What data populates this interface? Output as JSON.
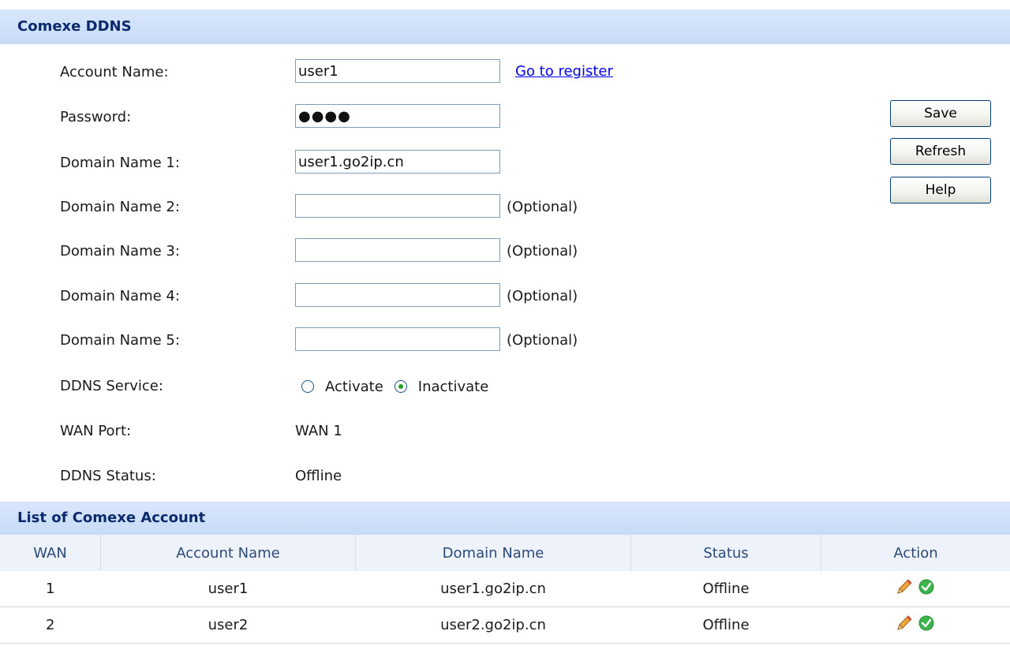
{
  "ddns_section": {
    "title": "Comexe DDNS"
  },
  "form": {
    "account_name": {
      "label": "Account Name:",
      "value": "user1",
      "register_link": "Go to register"
    },
    "password": {
      "label": "Password:",
      "value": "●●●●"
    },
    "domain1": {
      "label": "Domain Name 1:",
      "value": "user1.go2ip.cn"
    },
    "domain2": {
      "label": "Domain Name 2:",
      "value": "",
      "hint": "(Optional)"
    },
    "domain3": {
      "label": "Domain Name 3:",
      "value": "",
      "hint": "(Optional)"
    },
    "domain4": {
      "label": "Domain Name 4:",
      "value": "",
      "hint": "(Optional)"
    },
    "domain5": {
      "label": "Domain Name 5:",
      "value": "",
      "hint": "(Optional)"
    },
    "ddns_service": {
      "label": "DDNS Service:",
      "options": [
        "Activate",
        "Inactivate"
      ],
      "selected": "Inactivate"
    },
    "wan_port": {
      "label": "WAN Port:",
      "value": "WAN 1"
    },
    "ddns_status": {
      "label": "DDNS Status:",
      "value": "Offline"
    }
  },
  "buttons": {
    "save": "Save",
    "refresh": "Refresh",
    "help": "Help"
  },
  "list_section": {
    "title": "List of Comexe Account"
  },
  "table": {
    "headers": [
      "WAN",
      "Account Name",
      "Domain Name",
      "Status",
      "Action"
    ],
    "rows": [
      {
        "wan": "1",
        "account": "user1",
        "domain": "user1.go2ip.cn",
        "status": "Offline",
        "actions": [
          "pencil-icon",
          "check-icon"
        ]
      },
      {
        "wan": "2",
        "account": "user2",
        "domain": "user2.go2ip.cn",
        "status": "Offline",
        "actions": [
          "pencil-icon",
          "check-icon"
        ]
      }
    ]
  },
  "colors": {
    "header_bg": "#c7daf7",
    "header_text": "#0b2a6e",
    "link": "#0000ee",
    "check_green": "#3bb54a",
    "pencil_orange": "#e8962a"
  }
}
